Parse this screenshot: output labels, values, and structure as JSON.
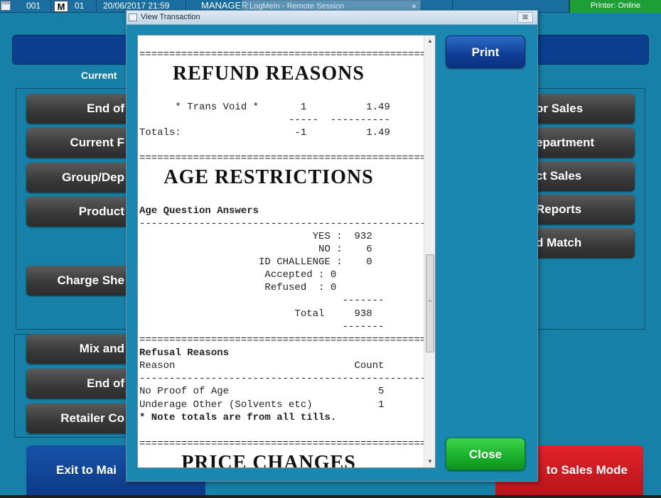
{
  "topbar": {
    "icon_label": "ODS",
    "store": "001",
    "mode": "M",
    "till": "01",
    "datetime": "20/06/2017 21:59",
    "user": "MANAGER",
    "remote_banner": "LogMeIn - Remote Session",
    "remote_close": "×",
    "printer_status": "Printer: Online"
  },
  "main": {
    "current_label": "Current",
    "left_buttons": [
      "End of",
      "Current F",
      "Group/Dep",
      "Product",
      "Charge She",
      "Mix and",
      "End of",
      "Retailer Co"
    ],
    "right_buttons": [
      "or Sales",
      "epartment",
      "ct Sales",
      "Reports",
      "d Match"
    ],
    "exit_button": "Exit to Mai",
    "sales_button": "to Sales Mode"
  },
  "dialog": {
    "title": "View Transaction",
    "close_glyph": "⊠",
    "print_label": "Print",
    "close_label": "Close",
    "receipt": {
      "sep_eq": "================================================",
      "sep_dash": "------------------------------------------------",
      "refund_title": "REFUND REASONS",
      "trans_void_line": "      * Trans Void *       1          1.49",
      "refund_sub_dash": "                         -----  ----------",
      "totals_line": "Totals:                   -1          1.49",
      "age_title": "AGE RESTRICTIONS",
      "age_question": "Age Question Answers",
      "yes_line": "                             YES :  932",
      "no_line": "                              NO :    6",
      "id_line": "                    ID CHALLENGE :    0",
      "accepted_line": "                     Accepted : 0",
      "refused_line": "                     Refused  : 0",
      "total_dash": "                                  -------",
      "total_line": "                          Total     938",
      "refusal_title": "Refusal Reasons",
      "reason_header": "Reason                              Count",
      "no_proof_line": "No Proof of Age                         5",
      "underage_line": "Underage Other (Solvents etc)           1",
      "note_line": "* Note totals are from all tills.",
      "price_title": "PRICE CHANGES"
    }
  }
}
